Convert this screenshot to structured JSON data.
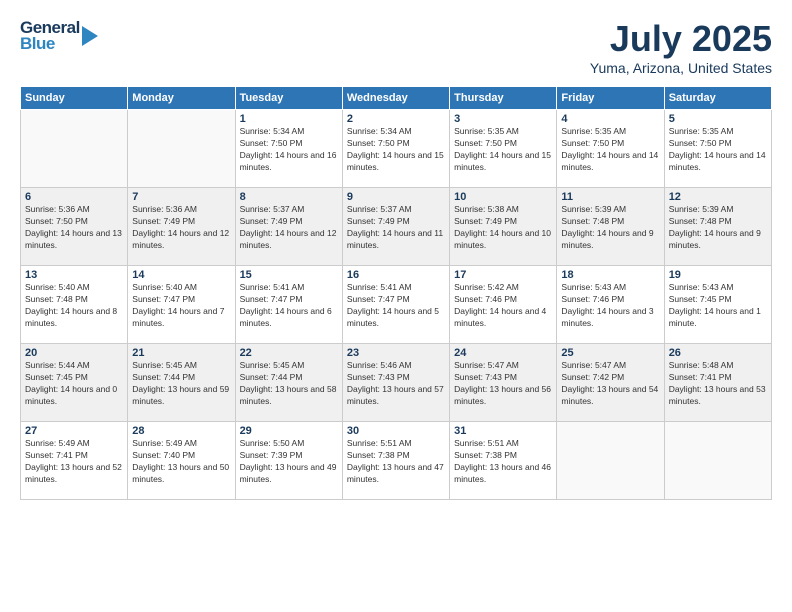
{
  "logo": {
    "line1": "General",
    "line2": "Blue"
  },
  "header": {
    "month": "July 2025",
    "location": "Yuma, Arizona, United States"
  },
  "weekdays": [
    "Sunday",
    "Monday",
    "Tuesday",
    "Wednesday",
    "Thursday",
    "Friday",
    "Saturday"
  ],
  "weeks": [
    [
      {
        "day": "",
        "sunrise": "",
        "sunset": "",
        "daylight": ""
      },
      {
        "day": "",
        "sunrise": "",
        "sunset": "",
        "daylight": ""
      },
      {
        "day": "1",
        "sunrise": "Sunrise: 5:34 AM",
        "sunset": "Sunset: 7:50 PM",
        "daylight": "Daylight: 14 hours and 16 minutes."
      },
      {
        "day": "2",
        "sunrise": "Sunrise: 5:34 AM",
        "sunset": "Sunset: 7:50 PM",
        "daylight": "Daylight: 14 hours and 15 minutes."
      },
      {
        "day": "3",
        "sunrise": "Sunrise: 5:35 AM",
        "sunset": "Sunset: 7:50 PM",
        "daylight": "Daylight: 14 hours and 15 minutes."
      },
      {
        "day": "4",
        "sunrise": "Sunrise: 5:35 AM",
        "sunset": "Sunset: 7:50 PM",
        "daylight": "Daylight: 14 hours and 14 minutes."
      },
      {
        "day": "5",
        "sunrise": "Sunrise: 5:35 AM",
        "sunset": "Sunset: 7:50 PM",
        "daylight": "Daylight: 14 hours and 14 minutes."
      }
    ],
    [
      {
        "day": "6",
        "sunrise": "Sunrise: 5:36 AM",
        "sunset": "Sunset: 7:50 PM",
        "daylight": "Daylight: 14 hours and 13 minutes."
      },
      {
        "day": "7",
        "sunrise": "Sunrise: 5:36 AM",
        "sunset": "Sunset: 7:49 PM",
        "daylight": "Daylight: 14 hours and 12 minutes."
      },
      {
        "day": "8",
        "sunrise": "Sunrise: 5:37 AM",
        "sunset": "Sunset: 7:49 PM",
        "daylight": "Daylight: 14 hours and 12 minutes."
      },
      {
        "day": "9",
        "sunrise": "Sunrise: 5:37 AM",
        "sunset": "Sunset: 7:49 PM",
        "daylight": "Daylight: 14 hours and 11 minutes."
      },
      {
        "day": "10",
        "sunrise": "Sunrise: 5:38 AM",
        "sunset": "Sunset: 7:49 PM",
        "daylight": "Daylight: 14 hours and 10 minutes."
      },
      {
        "day": "11",
        "sunrise": "Sunrise: 5:39 AM",
        "sunset": "Sunset: 7:48 PM",
        "daylight": "Daylight: 14 hours and 9 minutes."
      },
      {
        "day": "12",
        "sunrise": "Sunrise: 5:39 AM",
        "sunset": "Sunset: 7:48 PM",
        "daylight": "Daylight: 14 hours and 9 minutes."
      }
    ],
    [
      {
        "day": "13",
        "sunrise": "Sunrise: 5:40 AM",
        "sunset": "Sunset: 7:48 PM",
        "daylight": "Daylight: 14 hours and 8 minutes."
      },
      {
        "day": "14",
        "sunrise": "Sunrise: 5:40 AM",
        "sunset": "Sunset: 7:47 PM",
        "daylight": "Daylight: 14 hours and 7 minutes."
      },
      {
        "day": "15",
        "sunrise": "Sunrise: 5:41 AM",
        "sunset": "Sunset: 7:47 PM",
        "daylight": "Daylight: 14 hours and 6 minutes."
      },
      {
        "day": "16",
        "sunrise": "Sunrise: 5:41 AM",
        "sunset": "Sunset: 7:47 PM",
        "daylight": "Daylight: 14 hours and 5 minutes."
      },
      {
        "day": "17",
        "sunrise": "Sunrise: 5:42 AM",
        "sunset": "Sunset: 7:46 PM",
        "daylight": "Daylight: 14 hours and 4 minutes."
      },
      {
        "day": "18",
        "sunrise": "Sunrise: 5:43 AM",
        "sunset": "Sunset: 7:46 PM",
        "daylight": "Daylight: 14 hours and 3 minutes."
      },
      {
        "day": "19",
        "sunrise": "Sunrise: 5:43 AM",
        "sunset": "Sunset: 7:45 PM",
        "daylight": "Daylight: 14 hours and 1 minute."
      }
    ],
    [
      {
        "day": "20",
        "sunrise": "Sunrise: 5:44 AM",
        "sunset": "Sunset: 7:45 PM",
        "daylight": "Daylight: 14 hours and 0 minutes."
      },
      {
        "day": "21",
        "sunrise": "Sunrise: 5:45 AM",
        "sunset": "Sunset: 7:44 PM",
        "daylight": "Daylight: 13 hours and 59 minutes."
      },
      {
        "day": "22",
        "sunrise": "Sunrise: 5:45 AM",
        "sunset": "Sunset: 7:44 PM",
        "daylight": "Daylight: 13 hours and 58 minutes."
      },
      {
        "day": "23",
        "sunrise": "Sunrise: 5:46 AM",
        "sunset": "Sunset: 7:43 PM",
        "daylight": "Daylight: 13 hours and 57 minutes."
      },
      {
        "day": "24",
        "sunrise": "Sunrise: 5:47 AM",
        "sunset": "Sunset: 7:43 PM",
        "daylight": "Daylight: 13 hours and 56 minutes."
      },
      {
        "day": "25",
        "sunrise": "Sunrise: 5:47 AM",
        "sunset": "Sunset: 7:42 PM",
        "daylight": "Daylight: 13 hours and 54 minutes."
      },
      {
        "day": "26",
        "sunrise": "Sunrise: 5:48 AM",
        "sunset": "Sunset: 7:41 PM",
        "daylight": "Daylight: 13 hours and 53 minutes."
      }
    ],
    [
      {
        "day": "27",
        "sunrise": "Sunrise: 5:49 AM",
        "sunset": "Sunset: 7:41 PM",
        "daylight": "Daylight: 13 hours and 52 minutes."
      },
      {
        "day": "28",
        "sunrise": "Sunrise: 5:49 AM",
        "sunset": "Sunset: 7:40 PM",
        "daylight": "Daylight: 13 hours and 50 minutes."
      },
      {
        "day": "29",
        "sunrise": "Sunrise: 5:50 AM",
        "sunset": "Sunset: 7:39 PM",
        "daylight": "Daylight: 13 hours and 49 minutes."
      },
      {
        "day": "30",
        "sunrise": "Sunrise: 5:51 AM",
        "sunset": "Sunset: 7:38 PM",
        "daylight": "Daylight: 13 hours and 47 minutes."
      },
      {
        "day": "31",
        "sunrise": "Sunrise: 5:51 AM",
        "sunset": "Sunset: 7:38 PM",
        "daylight": "Daylight: 13 hours and 46 minutes."
      },
      {
        "day": "",
        "sunrise": "",
        "sunset": "",
        "daylight": ""
      },
      {
        "day": "",
        "sunrise": "",
        "sunset": "",
        "daylight": ""
      }
    ]
  ]
}
